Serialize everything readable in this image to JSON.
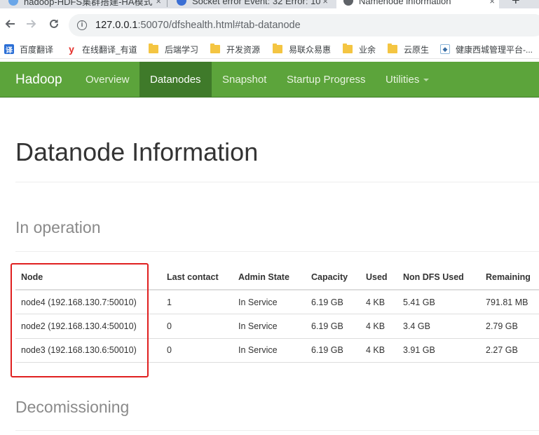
{
  "browser": {
    "tabs": [
      {
        "title": "hadoop-HDFS集群搭建-HA模式",
        "close": "×"
      },
      {
        "title": "Socket error Event: 32 Error: 10",
        "close": "×"
      },
      {
        "title": "Namenode information",
        "close": "×"
      }
    ],
    "new_tab": "+",
    "url_host": "127.0.0.1",
    "url_rest": ":50070/dfshealth.html#tab-datanode"
  },
  "bookmarks": [
    {
      "label": "百度翻译",
      "icon": "baidu-translate-icon",
      "color": "#2b6fd6"
    },
    {
      "label": "在线翻译_有道",
      "icon": "youdao-icon",
      "color": "#e5322d"
    },
    {
      "label": "后端学习",
      "icon": "folder-icon"
    },
    {
      "label": "开发资源",
      "icon": "folder-icon"
    },
    {
      "label": "易联众易惠",
      "icon": "folder-icon"
    },
    {
      "label": "业余",
      "icon": "folder-icon"
    },
    {
      "label": "云原生",
      "icon": "folder-icon"
    },
    {
      "label": "健康西城管理平台-...",
      "icon": "site-icon"
    }
  ],
  "navbar": {
    "brand": "Hadoop",
    "items": [
      "Overview",
      "Datanodes",
      "Snapshot",
      "Startup Progress",
      "Utilities"
    ],
    "active": "Datanodes",
    "color": "#5ca43b"
  },
  "page": {
    "title": "Datanode Information",
    "section_in_operation": "In operation",
    "section_decom": "Decomissioning"
  },
  "table": {
    "headers": [
      "Node",
      "Last contact",
      "Admin State",
      "Capacity",
      "Used",
      "Non DFS Used",
      "Remaining"
    ],
    "rows": [
      [
        "node4 (192.168.130.7:50010)",
        "1",
        "In Service",
        "6.19 GB",
        "4 KB",
        "5.41 GB",
        "791.81 MB"
      ],
      [
        "node2 (192.168.130.4:50010)",
        "0",
        "In Service",
        "6.19 GB",
        "4 KB",
        "3.4 GB",
        "2.79 GB"
      ],
      [
        "node3 (192.168.130.6:50010)",
        "0",
        "In Service",
        "6.19 GB",
        "4 KB",
        "3.91 GB",
        "2.27 GB"
      ]
    ]
  },
  "annotation_color": "#e02020"
}
